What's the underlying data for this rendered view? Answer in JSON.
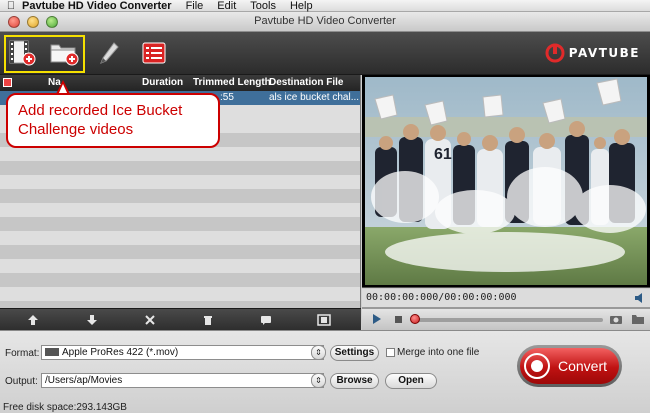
{
  "menubar": {
    "app_name": "Pavtube HD Video Converter",
    "items": [
      "File",
      "Edit",
      "Tools",
      "Help"
    ]
  },
  "window": {
    "title": "Pavtube HD Video Converter"
  },
  "toolbar": {
    "buttons": [
      "add-video-icon",
      "add-folder-icon",
      "edit-pencil-icon",
      "task-list-icon"
    ],
    "brand": "PAVTUBE"
  },
  "callout": {
    "text": "Add recorded Ice Bucket Challenge videos"
  },
  "file_list": {
    "columns": [
      "Na",
      "Duration",
      "Trimmed Length",
      "Destination File"
    ],
    "rows": [
      {
        "trimmed_length": ":55",
        "destination": "als ice bucket chal..."
      }
    ]
  },
  "preview": {
    "timecode": "00:00:00:000/00:00:00:000",
    "jersey_number": "61"
  },
  "playback": {
    "progress_fraction": 0.0
  },
  "settings": {
    "format_label": "Format:",
    "format_value": "Apple ProRes 422 (*.mov)",
    "settings_button": "Settings",
    "merge_label": "Merge into one file",
    "merge_checked": false,
    "output_label": "Output:",
    "output_value": "/Users/ap/Movies",
    "browse_button": "Browse",
    "open_button": "Open",
    "convert_button": "Convert",
    "free_disk_space": "Free disk space:293.143GB"
  },
  "colors": {
    "highlight": "#f5e000",
    "callout": "#cc0000",
    "selected_row": "#3f6f9a",
    "convert": "#c81e1e"
  }
}
